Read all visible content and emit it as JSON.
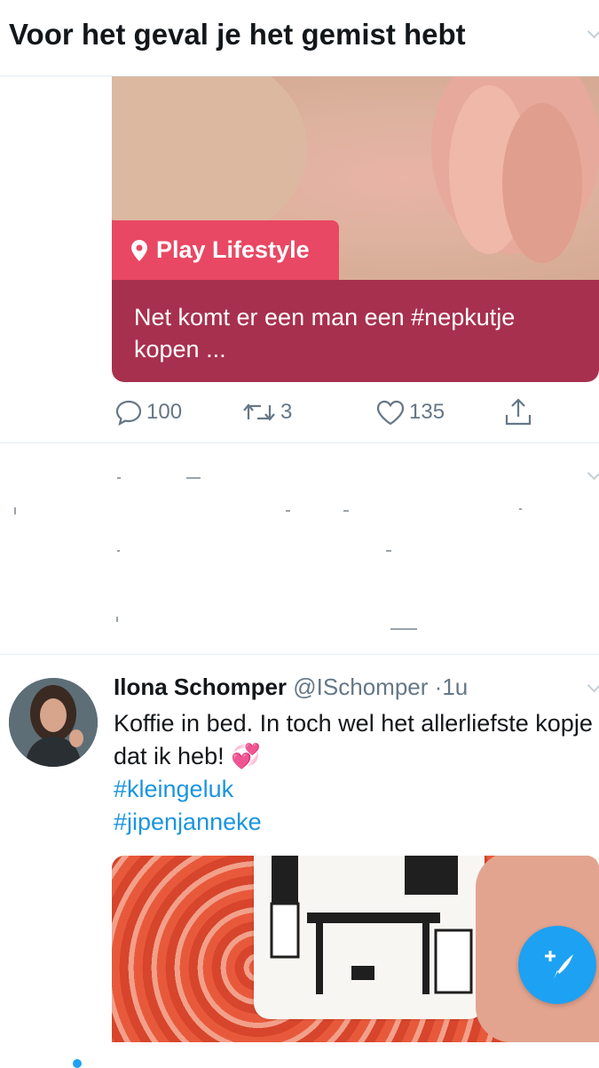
{
  "section": {
    "title": "Voor het geval je het gemist hebt"
  },
  "card_tweet": {
    "tag_label": "Play Lifestyle",
    "card_text": "Net komt er een man een #nepkutje kopen ...",
    "reply_count": "100",
    "retweet_count": "3",
    "like_count": "135"
  },
  "tweet": {
    "name": "Ilona Schomper",
    "handle": "@ISchomper",
    "separator": "·",
    "time": "1u",
    "text": "Koffie in bed. In toch wel het allerliefste kopje dat ik heb! 💞",
    "hashtags": [
      "#kleingeluk",
      "#jipenjanneke"
    ]
  },
  "icons": {
    "reply": "reply-icon",
    "retweet": "retweet-icon",
    "like": "heart-icon",
    "share": "share-icon",
    "compose": "compose-tweet-icon",
    "location": "location-pin-icon"
  },
  "colors": {
    "accent": "#1da1f2",
    "card_tag": "#e84863",
    "card_body": "#a8304f",
    "hashtag": "#1b95e0"
  }
}
